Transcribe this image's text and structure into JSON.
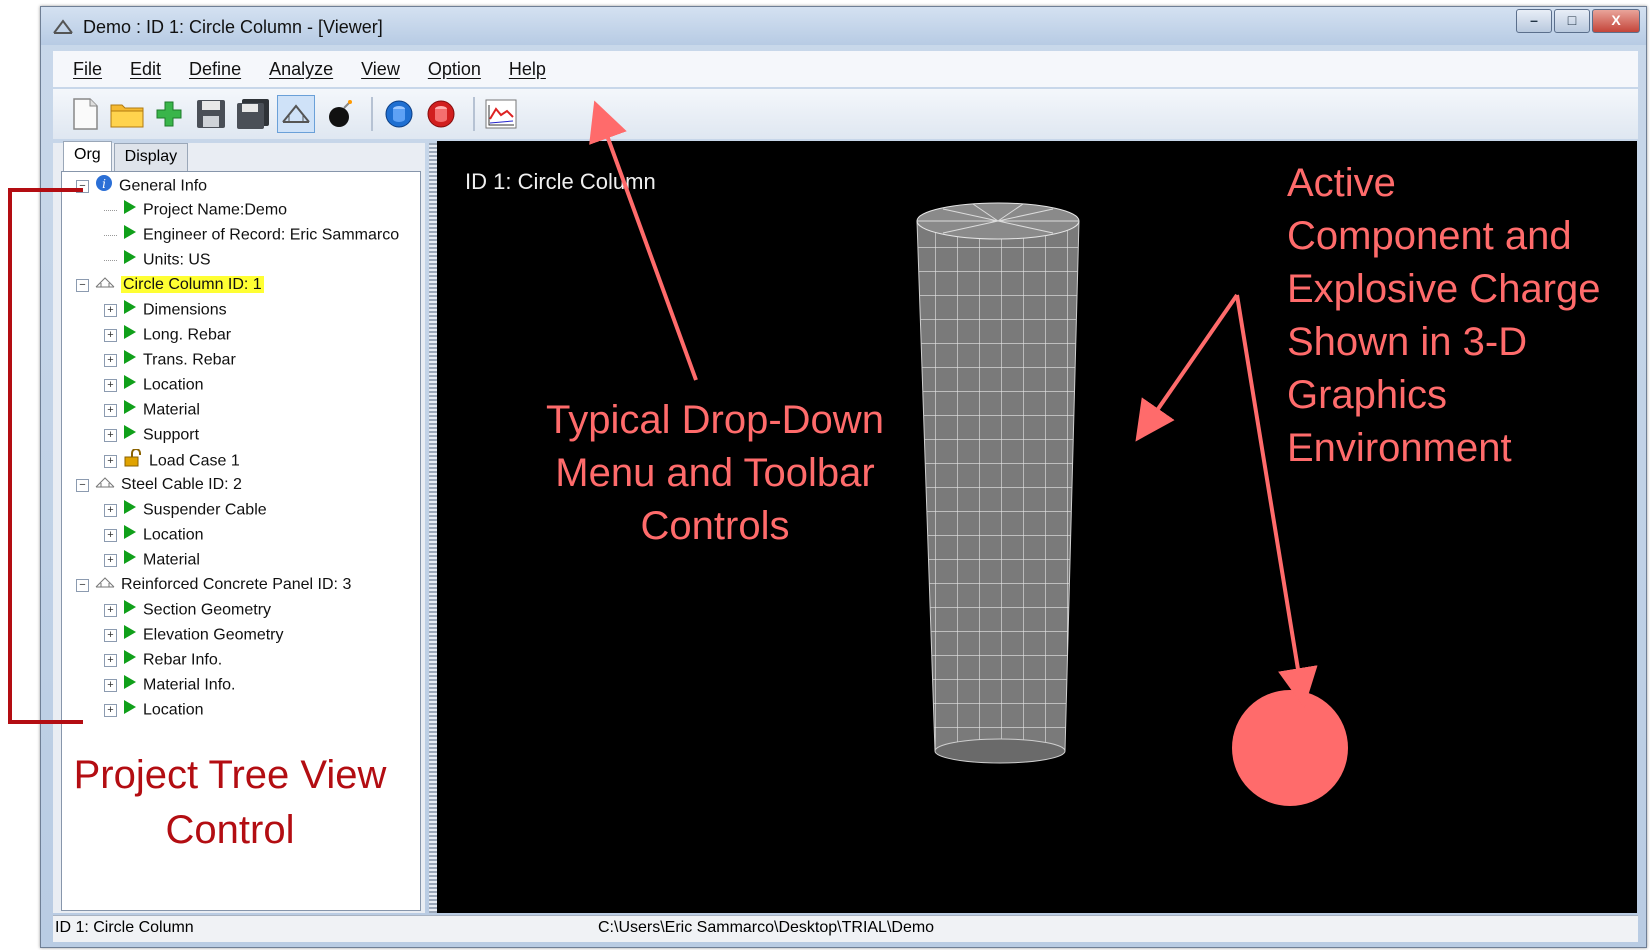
{
  "window": {
    "title": "Demo : ID 1: Circle Column - [Viewer]",
    "controls": {
      "minimize": "–",
      "maximize": "□",
      "close": "X"
    }
  },
  "menu": [
    "File",
    "Edit",
    "Define",
    "Analyze",
    "View",
    "Option",
    "Help"
  ],
  "toolbar": {
    "icons": [
      "new-file-icon",
      "open-folder-icon",
      "add-plus-icon",
      "save-icon",
      "save-all-icon",
      "bridge-component-icon",
      "bomb-icon",
      "blue-cylinder-icon",
      "red-cylinder-icon",
      "chart-icon"
    ]
  },
  "tabs": [
    "Org",
    "Display"
  ],
  "tree": [
    {
      "label": "General Info",
      "level": 0,
      "icon": "info-icon",
      "expander": "−"
    },
    {
      "label": "Project Name:Demo",
      "level": 1,
      "icon": "play-icon"
    },
    {
      "label": "Engineer of Record: Eric Sammarco",
      "level": 1,
      "icon": "play-icon"
    },
    {
      "label": "Units: US",
      "level": 1,
      "icon": "play-icon"
    },
    {
      "label": "Circle Column ID: 1",
      "level": 0,
      "icon": "bridge-icon",
      "expander": "−",
      "highlight": true
    },
    {
      "label": "Dimensions",
      "level": 1,
      "icon": "play-icon",
      "expander": "+"
    },
    {
      "label": "Long. Rebar",
      "level": 1,
      "icon": "play-icon",
      "expander": "+"
    },
    {
      "label": "Trans. Rebar",
      "level": 1,
      "icon": "play-icon",
      "expander": "+"
    },
    {
      "label": "Location",
      "level": 1,
      "icon": "play-icon",
      "expander": "+"
    },
    {
      "label": "Material",
      "level": 1,
      "icon": "play-icon",
      "expander": "+"
    },
    {
      "label": "Support",
      "level": 1,
      "icon": "play-icon",
      "expander": "+"
    },
    {
      "label": "Load Case 1",
      "level": 1,
      "icon": "lock-icon",
      "expander": "+"
    },
    {
      "label": "Steel Cable ID: 2",
      "level": 0,
      "icon": "bridge-icon",
      "expander": "−"
    },
    {
      "label": "Suspender Cable",
      "level": 1,
      "icon": "play-icon",
      "expander": "+"
    },
    {
      "label": "Location",
      "level": 1,
      "icon": "play-icon",
      "expander": "+"
    },
    {
      "label": "Material",
      "level": 1,
      "icon": "play-icon",
      "expander": "+"
    },
    {
      "label": "Reinforced Concrete Panel ID: 3",
      "level": 0,
      "icon": "bridge-icon",
      "expander": "−"
    },
    {
      "label": "Section Geometry",
      "level": 1,
      "icon": "play-icon",
      "expander": "+"
    },
    {
      "label": "Elevation Geometry",
      "level": 1,
      "icon": "play-icon",
      "expander": "+"
    },
    {
      "label": "Rebar Info.",
      "level": 1,
      "icon": "play-icon",
      "expander": "+"
    },
    {
      "label": "Material Info.",
      "level": 1,
      "icon": "play-icon",
      "expander": "+"
    },
    {
      "label": "Location",
      "level": 1,
      "icon": "play-icon",
      "expander": "+"
    }
  ],
  "viewer": {
    "label": "ID 1: Circle Column"
  },
  "status": {
    "left": "ID 1: Circle Column",
    "path": "C:\\Users\\Eric Sammarco\\Desktop\\TRIAL\\Demo"
  },
  "annotations": {
    "toolbar_note": [
      "Typical Drop-Down",
      "Menu and Toolbar",
      "Controls"
    ],
    "graphics_note": [
      "Active",
      "Component and",
      "Explosive Charge",
      "Shown in 3-D",
      "Graphics",
      "Environment"
    ],
    "tree_note": [
      "Project Tree View",
      "Control"
    ]
  },
  "colors": {
    "annotation": "#ff6b6b",
    "annotation_dark": "#b30d12",
    "highlight": "#ffff33",
    "viewer_bg": "#000000",
    "charge": "#ff6b6b"
  }
}
